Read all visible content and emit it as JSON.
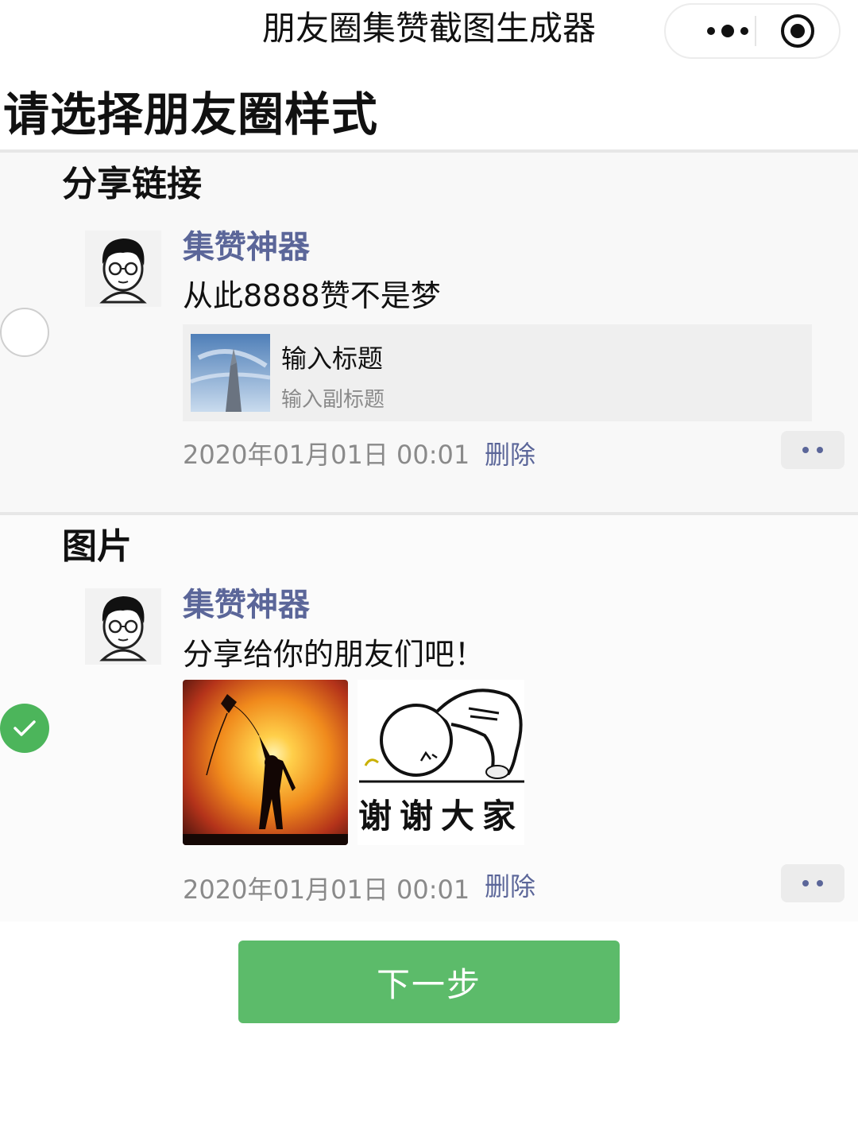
{
  "header": {
    "title": "朋友圈集赞截图生成器",
    "more_icon": "more-dots-icon",
    "close_icon": "target-icon"
  },
  "page_heading": "请选择朋友圈样式",
  "accent_colors": {
    "nickname": "#5b6699",
    "selected": "#4cb55b",
    "button": "#5cbb6a"
  },
  "styles": [
    {
      "section_title": "分享链接",
      "selected": false,
      "nickname": "集赞神器",
      "text": "从此8888赞不是梦",
      "link_card": {
        "title": "输入标题",
        "subtitle": "输入副标题"
      },
      "time": "2020年01月01日 00:01",
      "delete_label": "删除"
    },
    {
      "section_title": "图片",
      "selected": true,
      "nickname": "集赞神器",
      "text": "分享给你的朋友们吧！",
      "images": [
        {
          "name": "kite-sunset-photo"
        },
        {
          "name": "thanks-sticker",
          "caption": "谢谢大家"
        }
      ],
      "time": "2020年01月01日 00:01",
      "delete_label": "删除"
    }
  ],
  "next_button_label": "下一步"
}
